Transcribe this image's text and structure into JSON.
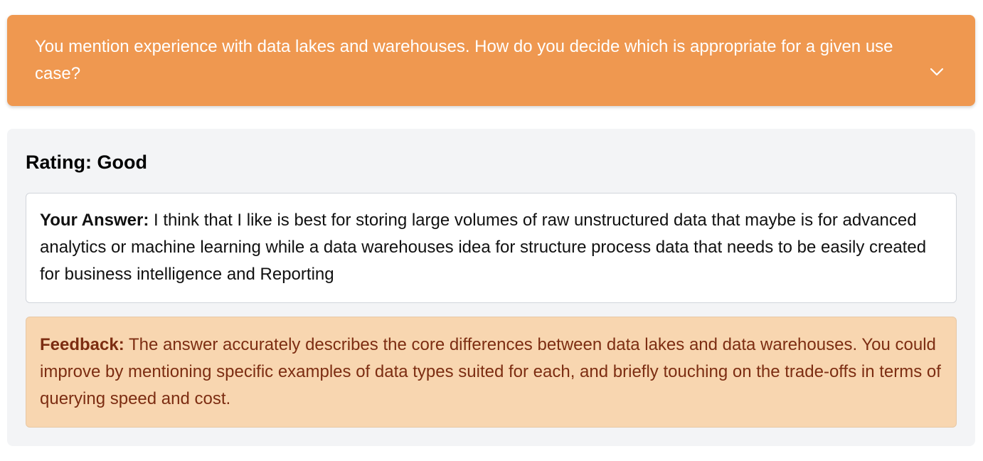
{
  "question": {
    "text": "You mention experience with data lakes and warehouses. How do you decide which is appropriate for a given use case?",
    "toggle_icon": "chevron-down-icon"
  },
  "evaluation": {
    "rating_label": "Rating: Good",
    "answer": {
      "label": "Your Answer:",
      "text": " I think that I like is best for storing large volumes of raw unstructured data that maybe is for advanced analytics or machine learning while a data warehouses idea for structure process data that needs to be easily created for business intelligence and Reporting"
    },
    "feedback": {
      "label": "Feedback:",
      "text": " The answer accurately describes the core differences between data lakes and data warehouses. You could improve by mentioning specific examples of data types suited for each, and briefly touching on the trade-offs in terms of querying speed and cost."
    }
  },
  "colors": {
    "question_bg": "#ef9850",
    "panel_bg": "#f3f4f6",
    "feedback_bg": "#f8d6b0",
    "feedback_text": "#7c2d12"
  }
}
